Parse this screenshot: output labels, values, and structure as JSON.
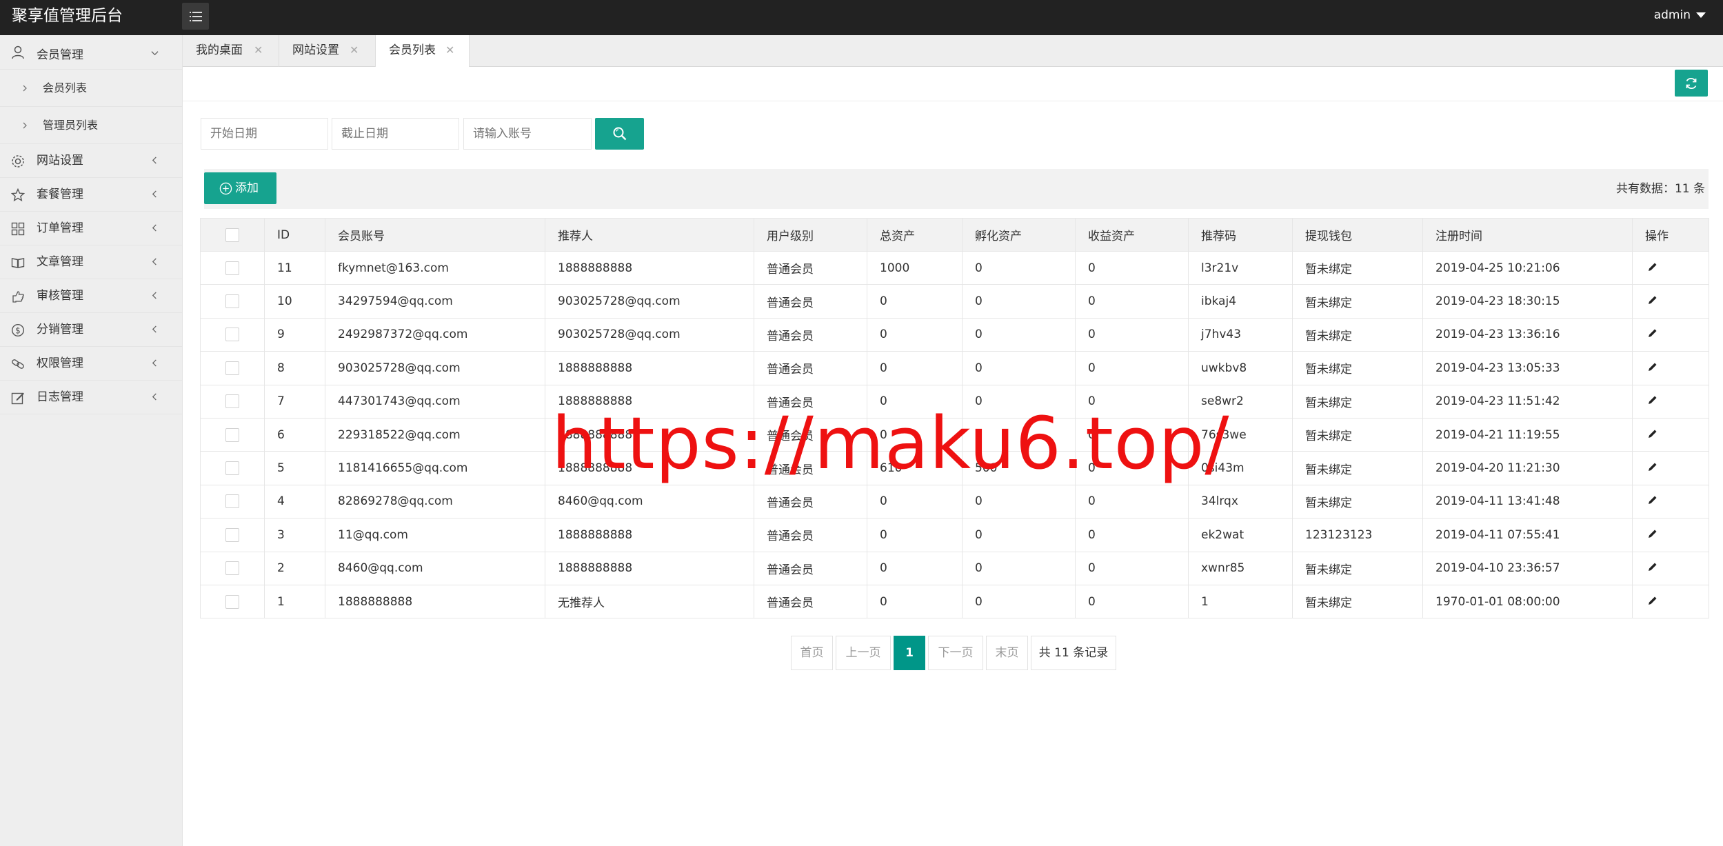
{
  "header": {
    "app_title": "聚享值管理后台",
    "user_name": "admin"
  },
  "sidebar": {
    "items": [
      {
        "label": "会员管理",
        "icon": "user-icon",
        "expanded": true,
        "children": [
          {
            "label": "会员列表"
          },
          {
            "label": "管理员列表"
          }
        ]
      },
      {
        "label": "网站设置",
        "icon": "gear-icon"
      },
      {
        "label": "套餐管理",
        "icon": "star-icon"
      },
      {
        "label": "订单管理",
        "icon": "grid-icon"
      },
      {
        "label": "文章管理",
        "icon": "book-icon"
      },
      {
        "label": "审核管理",
        "icon": "hand-icon"
      },
      {
        "label": "分销管理",
        "icon": "dollar-icon"
      },
      {
        "label": "权限管理",
        "icon": "link-icon"
      },
      {
        "label": "日志管理",
        "icon": "edit-icon"
      }
    ]
  },
  "tabs": [
    {
      "label": "我的桌面",
      "close": "✕"
    },
    {
      "label": "网站设置",
      "close": "✕"
    },
    {
      "label": "会员列表",
      "close": "✕",
      "active": true
    }
  ],
  "search": {
    "start_placeholder": "开始日期",
    "end_placeholder": "截止日期",
    "account_placeholder": "请输入账号"
  },
  "actions": {
    "add_label": "添加",
    "count_text": "共有数据：11 条"
  },
  "table": {
    "columns": [
      "ID",
      "会员账号",
      "推荐人",
      "用户级别",
      "总资产",
      "孵化资产",
      "收益资产",
      "推荐码",
      "提现钱包",
      "注册时间",
      "操作"
    ],
    "rows": [
      [
        "11",
        "fkymnet@163.com",
        "1888888888",
        "普通会员",
        "1000",
        "0",
        "0",
        "l3r21v",
        "暂未绑定",
        "2019-04-25 10:21:06"
      ],
      [
        "10",
        "34297594@qq.com",
        "903025728@qq.com",
        "普通会员",
        "0",
        "0",
        "0",
        "ibkaj4",
        "暂未绑定",
        "2019-04-23 18:30:15"
      ],
      [
        "9",
        "2492987372@qq.com",
        "903025728@qq.com",
        "普通会员",
        "0",
        "0",
        "0",
        "j7hv43",
        "暂未绑定",
        "2019-04-23 13:36:16"
      ],
      [
        "8",
        "903025728@qq.com",
        "1888888888",
        "普通会员",
        "0",
        "0",
        "0",
        "uwkbv8",
        "暂未绑定",
        "2019-04-23 13:05:33"
      ],
      [
        "7",
        "447301743@qq.com",
        "1888888888",
        "普通会员",
        "0",
        "0",
        "0",
        "se8wr2",
        "暂未绑定",
        "2019-04-23 11:51:42"
      ],
      [
        "6",
        "229318522@qq.com",
        "1888888888",
        "普通会员",
        "0",
        "0",
        "0",
        "76s3we",
        "暂未绑定",
        "2019-04-21 11:19:55"
      ],
      [
        "5",
        "1181416655@qq.com",
        "1888888888",
        "普通会员",
        "610",
        "500",
        "0",
        "0si43m",
        "暂未绑定",
        "2019-04-20 11:21:30"
      ],
      [
        "4",
        "82869278@qq.com",
        "8460@qq.com",
        "普通会员",
        "0",
        "0",
        "0",
        "34lrqx",
        "暂未绑定",
        "2019-04-11 13:41:48"
      ],
      [
        "3",
        "11@qq.com",
        "1888888888",
        "普通会员",
        "0",
        "0",
        "0",
        "ek2wat",
        "123123123",
        "2019-04-11 07:55:41"
      ],
      [
        "2",
        "8460@qq.com",
        "1888888888",
        "普通会员",
        "0",
        "0",
        "0",
        "xwnr85",
        "暂未绑定",
        "2019-04-10 23:36:57"
      ],
      [
        "1",
        "1888888888",
        "无推荐人",
        "普通会员",
        "0",
        "0",
        "0",
        "1",
        "暂未绑定",
        "1970-01-01 08:00:00"
      ]
    ]
  },
  "pagination": {
    "first": "首页",
    "prev": "上一页",
    "current": "1",
    "next": "下一页",
    "last": "末页",
    "total": "共 11 条记录"
  },
  "watermark": "https://maku6.top/",
  "colors": {
    "accent": "#16a38f",
    "header_bg": "#222222",
    "sidebar_bg": "#eeeeee",
    "watermark": "#ee1111"
  }
}
